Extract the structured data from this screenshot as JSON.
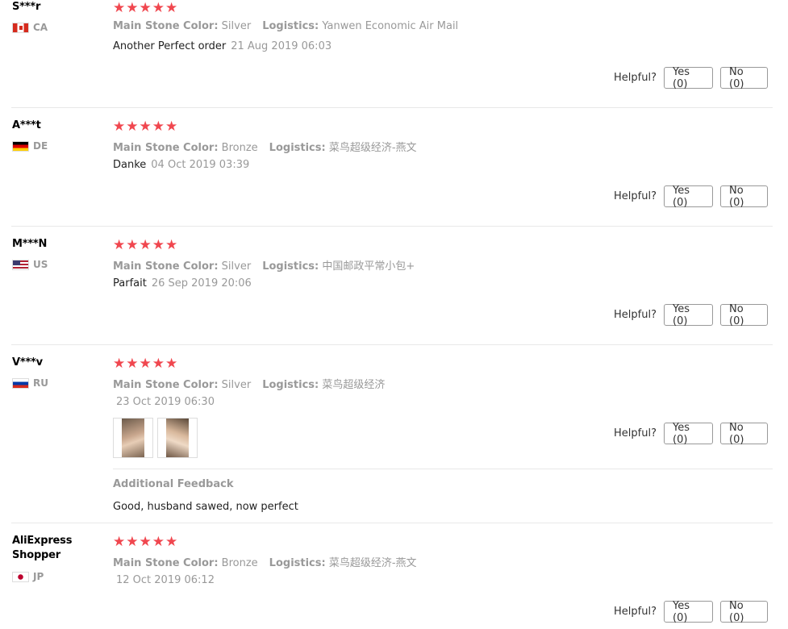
{
  "helpful_label": "Helpful?",
  "stars": "★★★★★",
  "labels": {
    "stone": "Main Stone Color:",
    "logistics": "Logistics:"
  },
  "reviews": [
    {
      "name": "S***r",
      "country": "CA",
      "stone_color": "Silver",
      "logistics": "Yanwen Economic Air Mail",
      "text": "Another Perfect order",
      "date": "21 Aug 2019 06:03",
      "yes": "Yes (0)",
      "no": "No (0)"
    },
    {
      "name": "A***t",
      "country": "DE",
      "stone_color": "Bronze",
      "logistics": "菜鸟超级经济-燕文",
      "text": "Danke",
      "date": "04 Oct 2019 03:39",
      "yes": "Yes (0)",
      "no": "No (0)"
    },
    {
      "name": "M***N",
      "country": "US",
      "stone_color": "Silver",
      "logistics": "中国邮政平常小包+",
      "text": "Parfait",
      "date": "26 Sep 2019 20:06",
      "yes": "Yes (0)",
      "no": "No (0)"
    },
    {
      "name": "V***v",
      "country": "RU",
      "stone_color": "Silver",
      "logistics": "菜鸟超级经济",
      "date": "23 Oct 2019 06:30",
      "additional_feedback_title": "Additional Feedback",
      "additional_feedback": "Good, husband sawed, now perfect",
      "yes": "Yes (0)",
      "no": "No (0)"
    },
    {
      "name_line1": "AliExpress",
      "name_line2": "Shopper",
      "country": "JP",
      "stone_color": "Bronze",
      "logistics": "菜鸟超级经济-燕文",
      "date": "12 Oct 2019 06:12",
      "yes": "Yes (0)",
      "no": "No (0)"
    }
  ]
}
